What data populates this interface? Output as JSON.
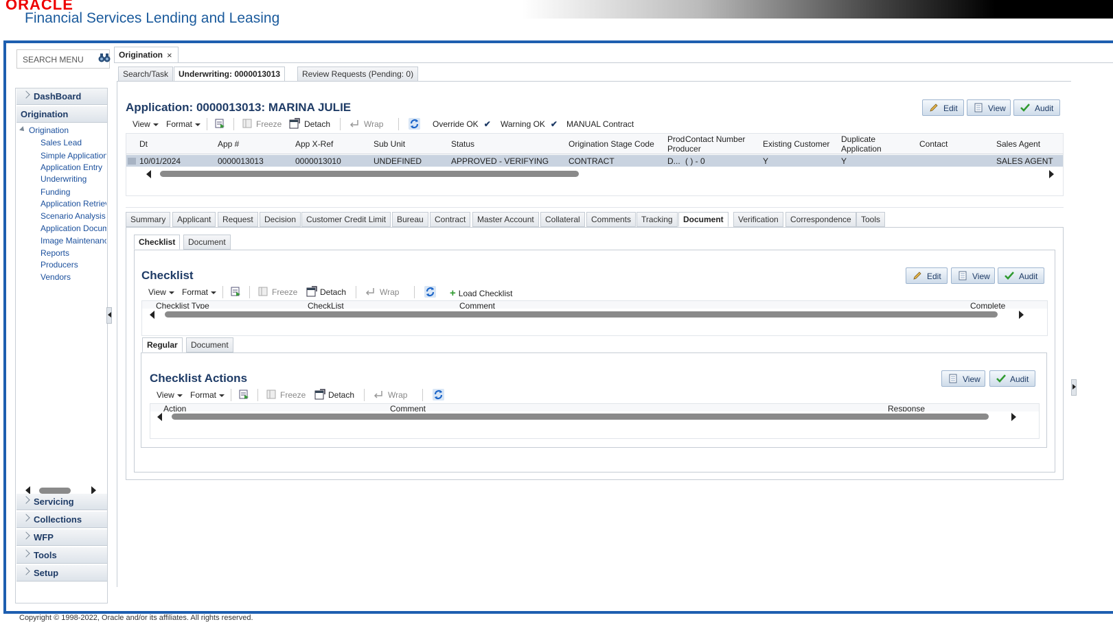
{
  "header": {
    "brand": "ORACLE",
    "product": "Financial Services Lending and Leasing"
  },
  "search": {
    "placeholder": "SEARCH MENU"
  },
  "nav": {
    "sections_top": [
      {
        "label": "DashBoard"
      },
      {
        "label": "Origination"
      }
    ],
    "tree_root": "Origination",
    "tree_items": [
      "Sales Lead",
      "Simple Application",
      "Application Entry",
      "Underwriting",
      "Funding",
      "Application Retrieval",
      "Scenario Analysis",
      "Application Document",
      "Image Maintenance",
      "Reports",
      "Producers",
      "Vendors"
    ],
    "sections_bottom": [
      {
        "label": "Servicing"
      },
      {
        "label": "Collections"
      },
      {
        "label": "WFP"
      },
      {
        "label": "Tools"
      },
      {
        "label": "Setup"
      }
    ]
  },
  "main_tab": {
    "label": "Origination",
    "close": "×"
  },
  "subtabs": [
    "Search/Task",
    "Underwriting: 0000013013",
    "Review Requests (Pending: 0)"
  ],
  "application": {
    "title": "Application: 0000013013: MARINA JULIE",
    "buttons": {
      "edit": "Edit",
      "view": "View",
      "audit": "Audit"
    },
    "toolbar": {
      "view": "View",
      "format": "Format",
      "freeze": "Freeze",
      "detach": "Detach",
      "wrap": "Wrap",
      "override": "Override OK",
      "warning": "Warning OK",
      "manual": "MANUAL Contract"
    },
    "columns": [
      "Dt",
      "App #",
      "App X-Ref",
      "Sub Unit",
      "Status",
      "Origination Stage Code",
      "Prod Producer Nam",
      "Contact Number",
      "Existing Customer",
      "Duplicate Application",
      "Contact",
      "Sales Agent"
    ],
    "row": [
      "10/01/2024",
      "0000013013",
      "0000013010",
      "UNDEFINED",
      "APPROVED - VERIFYING",
      "CONTRACT",
      "D...",
      "( ) - 0",
      "Y",
      "Y",
      "",
      "SALES AGENT"
    ]
  },
  "detail_tabs": [
    "Summary",
    "Applicant",
    "Request",
    "Decision",
    "Customer Credit Limit",
    "Bureau",
    "Contract",
    "Master Account",
    "Collateral",
    "Comments",
    "Tracking",
    "Document",
    "Verification",
    "Correspondence",
    "Tools"
  ],
  "doc_tabs": [
    "Checklist",
    "Document"
  ],
  "checklist": {
    "title": "Checklist",
    "buttons": {
      "edit": "Edit",
      "view": "View",
      "audit": "Audit"
    },
    "toolbar": {
      "view": "View",
      "format": "Format",
      "freeze": "Freeze",
      "detach": "Detach",
      "wrap": "Wrap",
      "load": "Load Checklist"
    },
    "columns": [
      "Checklist Type",
      "CheckList",
      "Comment",
      "Complete"
    ]
  },
  "regular_tabs": [
    "Regular",
    "Document"
  ],
  "checklist_actions": {
    "title": "Checklist Actions",
    "buttons": {
      "view": "View",
      "audit": "Audit"
    },
    "toolbar": {
      "view": "View",
      "format": "Format",
      "freeze": "Freeze",
      "detach": "Detach",
      "wrap": "Wrap"
    },
    "columns": [
      "Action",
      "Comment",
      "Response"
    ]
  },
  "footer": {
    "copyright": "Copyright © 1998-2022, Oracle and/or its affiliates. All rights reserved."
  },
  "colors": {
    "accent": "#1e5fb0",
    "brand_red": "#e00000",
    "title": "#1e3b66",
    "selected_row": "#c9d3e0"
  }
}
